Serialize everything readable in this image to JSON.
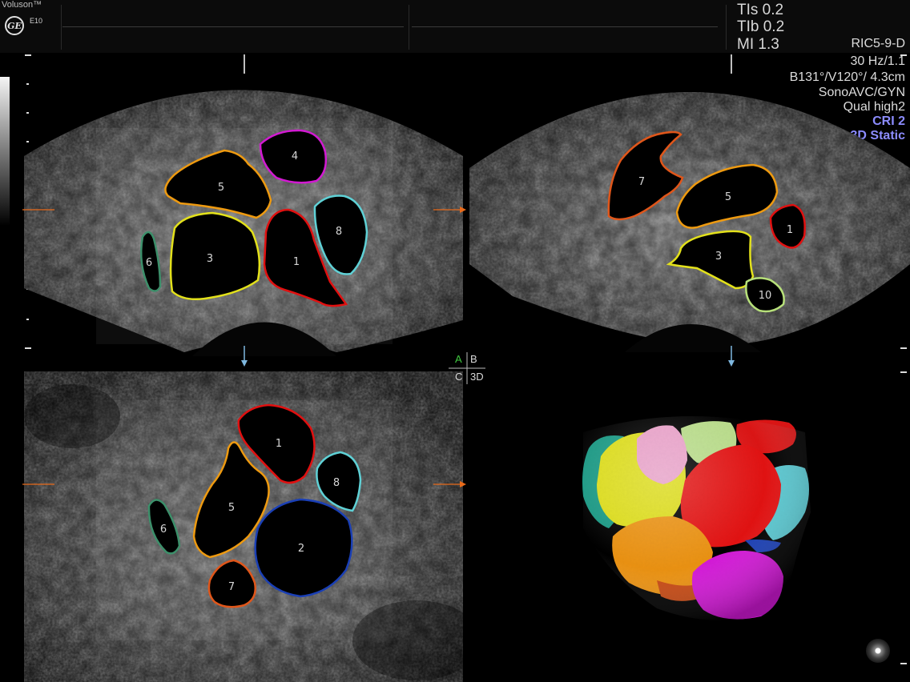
{
  "header": {
    "brand": "Voluson™",
    "logo_text": "GE",
    "model": "E10"
  },
  "indices": {
    "tis": "TIs 0.2",
    "tib": "TIb 0.2",
    "mi": "MI 1.3"
  },
  "params": [
    "RIC5-9-D",
    "30 Hz/1.1",
    "B131°/V120°/ 4.3cm",
    "SonoAVC/GYN",
    "Qual high2",
    "CRI 2",
    "3D Static"
  ],
  "quad_labels": {
    "a": "A",
    "b": "B",
    "c": "C",
    "d": "3D"
  },
  "panel_a_labels": [
    "5",
    "4",
    "8",
    "6",
    "3",
    "1"
  ],
  "panel_b_labels": [
    "7",
    "5",
    "1",
    "3",
    "10"
  ],
  "panel_c_labels": [
    "1",
    "8",
    "5",
    "6",
    "2",
    "7"
  ],
  "colors": {
    "follicle_1": "#e01010",
    "follicle_2": "#1a3fb5",
    "follicle_3": "#e3e11b",
    "follicle_4": "#d21ad2",
    "follicle_5": "#ee9a10",
    "follicle_6": "#3c8f6a",
    "follicle_7": "#e0561a",
    "follicle_8": "#5fd1d6",
    "follicle_10": "#b7e07a",
    "accent": "#8c8cff",
    "marker": "#e86a1a"
  }
}
